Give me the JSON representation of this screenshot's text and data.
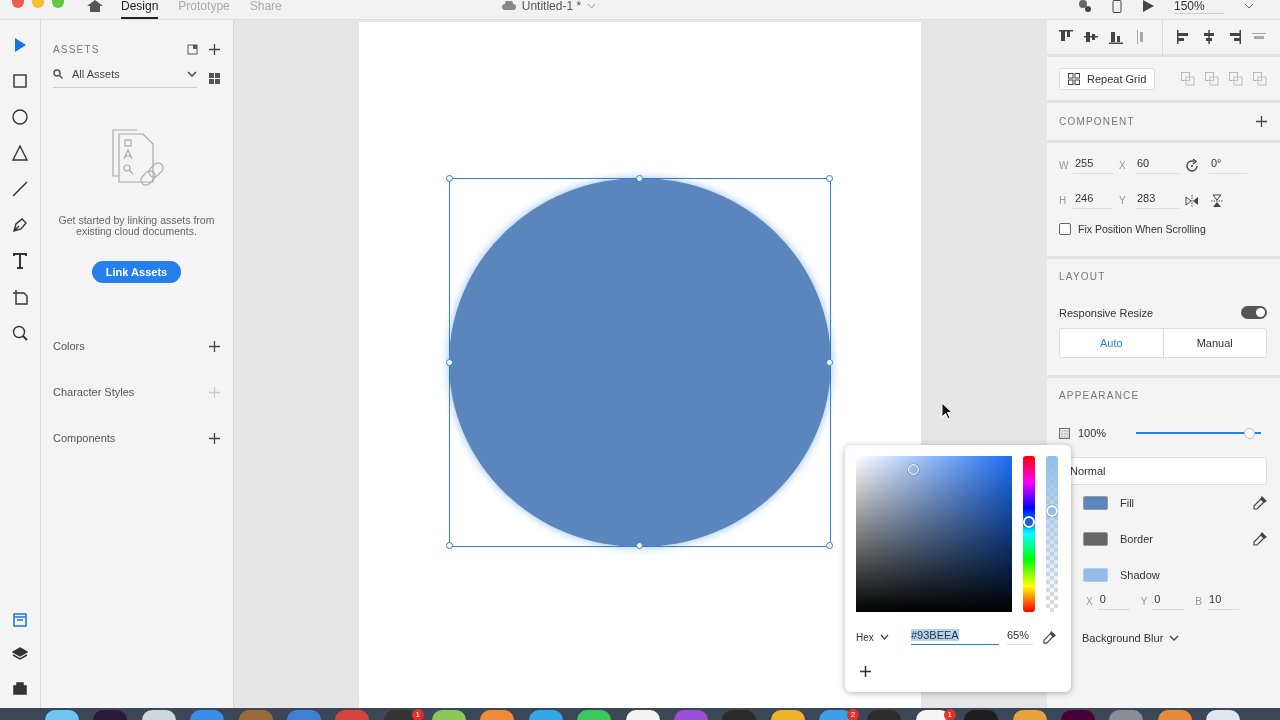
{
  "title_bar": {
    "tabs": [
      {
        "label": "Design",
        "selected": true
      },
      {
        "label": "Prototype",
        "selected": false
      },
      {
        "label": "Share",
        "selected": false
      }
    ],
    "document_title": "Untitled-1 *",
    "zoom": "150%"
  },
  "tools": [
    {
      "kind": "select",
      "selected": true
    },
    {
      "kind": "rectangle",
      "selected": false
    },
    {
      "kind": "ellipse",
      "selected": false
    },
    {
      "kind": "triangle",
      "selected": false
    },
    {
      "kind": "line",
      "selected": false
    },
    {
      "kind": "pen",
      "selected": false
    },
    {
      "kind": "text",
      "selected": false
    },
    {
      "kind": "artboard",
      "selected": false
    },
    {
      "kind": "zoom",
      "selected": false
    }
  ],
  "panel_tools": [
    {
      "kind": "assets",
      "selected": true
    },
    {
      "kind": "layers",
      "selected": false
    },
    {
      "kind": "plugins",
      "selected": false
    }
  ],
  "assets": {
    "title": "ASSETS",
    "search_value": "All Assets",
    "empty_message": "Get started by linking assets from existing cloud documents.",
    "link_button": "Link Assets",
    "sections": [
      {
        "label": "Colors",
        "disabled": false
      },
      {
        "label": "Character Styles",
        "disabled": true
      },
      {
        "label": "Components",
        "disabled": false
      }
    ]
  },
  "properties": {
    "repeat_grid": "Repeat Grid",
    "component_heading": "COMPONENT",
    "size_fields": [
      {
        "label": "W",
        "value": "255"
      },
      {
        "label": "X",
        "value": "60"
      },
      {
        "label": "H",
        "value": "246"
      },
      {
        "label": "Y",
        "value": "283"
      }
    ],
    "rotation": "0°",
    "fix_position": {
      "label": "Fix Position When Scrolling",
      "checked": false
    },
    "layout_heading": "LAYOUT",
    "responsive_resize": {
      "label": "Responsive Resize",
      "on": true
    },
    "resize_modes": [
      {
        "label": "Auto",
        "selected": true
      },
      {
        "label": "Manual",
        "selected": false
      }
    ],
    "appearance_heading": "APPEARANCE",
    "opacity": {
      "value": "100%",
      "level": 1
    },
    "blend_mode": "Normal",
    "styles": [
      {
        "kind": "fill",
        "label": "Fill",
        "color": "#5b85bd"
      },
      {
        "kind": "border",
        "label": "Border",
        "color": "#666666"
      },
      {
        "kind": "shadow",
        "label": "Shadow",
        "color": "#93beea"
      }
    ],
    "shadow_fields": [
      {
        "label": "X",
        "value": "0"
      },
      {
        "label": "Y",
        "value": "0"
      },
      {
        "label": "B",
        "value": "10"
      }
    ],
    "background_blur": "Background Blur"
  },
  "color_picker": {
    "mode": "Hex",
    "hex": "#93BEEA",
    "alpha": "65%",
    "alpha_slider": {
      "level": 0.65
    }
  },
  "dock": {
    "apps": [
      {
        "color": "#6ec6f0"
      },
      {
        "color": "#2a1a3a"
      },
      {
        "color": "#cfd6dc"
      },
      {
        "color": "#3a8ee6"
      },
      {
        "color": "#9b6a3c"
      },
      {
        "color": "#3f7fd6"
      },
      {
        "color": "#d6453d"
      },
      {
        "color": "#333333",
        "badge": "1"
      },
      {
        "color": "#8fc65a"
      },
      {
        "color": "#f08a3c"
      },
      {
        "color": "#35a7e8"
      },
      {
        "color": "#3cc85a"
      },
      {
        "color": "#f2f2f2"
      },
      {
        "color": "#9b4fd6"
      },
      {
        "color": "#2b2b2b"
      },
      {
        "color": "#f0b429"
      },
      {
        "color": "#3a9ee8",
        "badge": "2"
      },
      {
        "color": "#2e2e2e"
      },
      {
        "color": "#f5f5f5",
        "badge": "1"
      },
      {
        "color": "#1e1e1e"
      },
      {
        "color": "#e8a23c"
      },
      {
        "color": "#470137"
      },
      {
        "color": "#8a8f96"
      },
      {
        "color": "#e88a3c"
      },
      {
        "color": "#dfe6ec"
      }
    ]
  }
}
